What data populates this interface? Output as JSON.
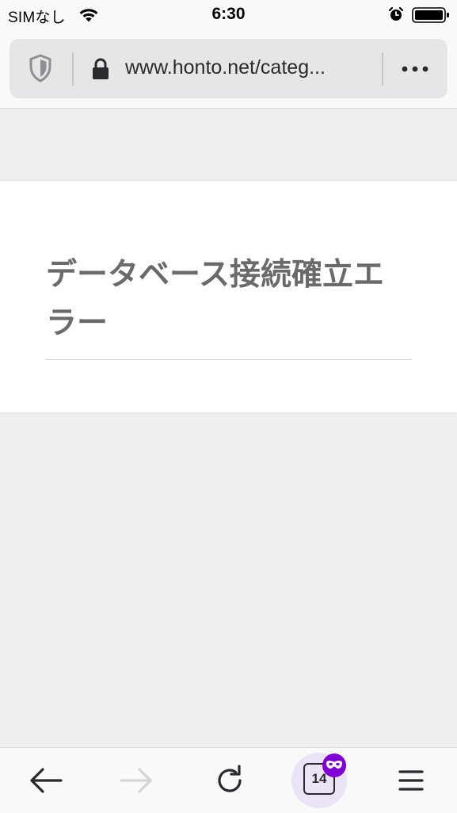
{
  "status_bar": {
    "carrier": "SIMなし",
    "time": "6:30"
  },
  "browser": {
    "url": "www.honto.net/categ..."
  },
  "page": {
    "error_title": "データベース接続確立エラー"
  },
  "toolbar": {
    "tab_count": "14"
  },
  "colors": {
    "private_accent": "#8000d7",
    "private_bg": "#ebe3f6"
  }
}
